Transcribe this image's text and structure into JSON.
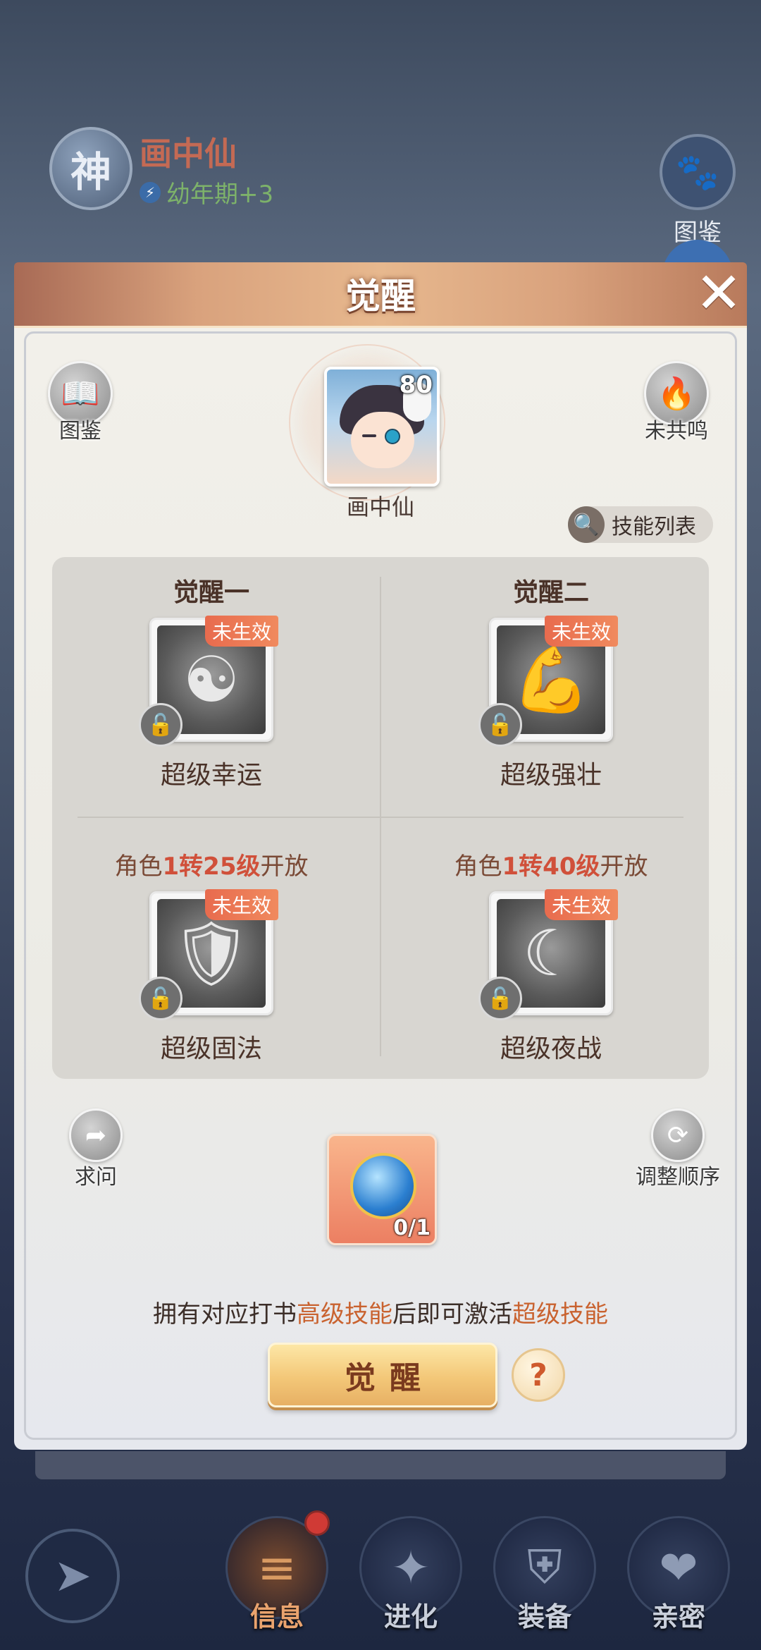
{
  "background": {
    "char_badge": "神",
    "pet_name": "画中仙",
    "stage_label": "幼年期+3",
    "dex_label": "图鉴",
    "nav": [
      {
        "label": "信息",
        "icon": "scroll-icon"
      },
      {
        "label": "进化",
        "icon": "sparkle-icon"
      },
      {
        "label": "装备",
        "icon": "armor-icon"
      },
      {
        "label": "亲密",
        "icon": "hearts-icon"
      }
    ]
  },
  "modal": {
    "title": "觉醒",
    "close_icon": "✕",
    "left_top_button": "图鉴",
    "right_top_button": "未共鸣",
    "pet": {
      "level": "80",
      "name": "画中仙"
    },
    "skill_list_button": "技能列表",
    "slots": [
      {
        "title": "觉醒一",
        "status": "未生效",
        "skill": "超级幸运",
        "icon": "koi-fish-icon"
      },
      {
        "title": "觉醒二",
        "status": "未生效",
        "skill": "超级强壮",
        "icon": "flexed-arm-icon"
      },
      {
        "req_prefix": "角色",
        "req_highlight": "1转25级",
        "req_suffix": "开放",
        "status": "未生效",
        "skill": "超级固法",
        "icon": "flame-shield-icon"
      },
      {
        "req_prefix": "角色",
        "req_highlight": "1转40级",
        "req_suffix": "开放",
        "status": "未生效",
        "skill": "超级夜战",
        "icon": "crescent-moon-icon"
      }
    ],
    "ask_button": "求问",
    "reorder_button": "调整顺序",
    "item_count": "0/1",
    "hint": {
      "p1": "拥有对应打书",
      "h1": "高级技能",
      "p2": "后即可激活",
      "h2": "超级技能"
    },
    "awaken_button": "觉醒",
    "help_button": "?"
  }
}
